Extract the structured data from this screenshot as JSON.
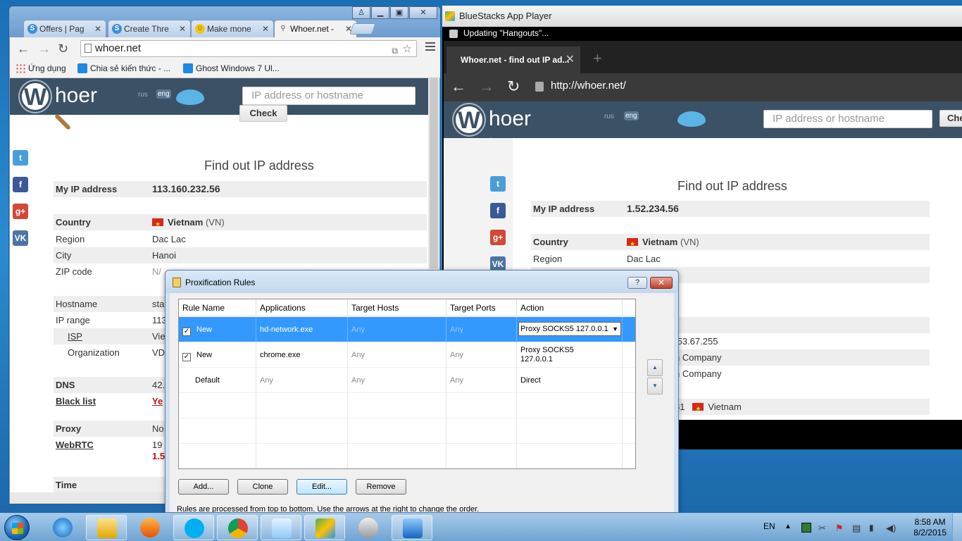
{
  "chrome": {
    "tabs": [
      {
        "label": "Offers | Pag",
        "icon": "skype-icon"
      },
      {
        "label": "Create Thre",
        "icon": "skype-icon"
      },
      {
        "label": "Make mone",
        "icon": "smiley-icon"
      },
      {
        "label": "Whoer.net -",
        "icon": "search-icon"
      }
    ],
    "url": "whoer.net",
    "bookmarks": [
      {
        "label": "Ứng dụng",
        "icon": "apps-grid-icon"
      },
      {
        "label": "Chia sẻ kiến thức - ...",
        "icon": "windows-icon"
      },
      {
        "label": "Ghost Windows 7 Ul...",
        "icon": "windows-icon"
      }
    ]
  },
  "whoer": {
    "logo_w": "W",
    "logo_rest": "hoer",
    "lang_rus": "rus",
    "lang_eng": "eng",
    "search_placeholder": "IP address or hostname",
    "check_label": "Check",
    "title": "Find out IP address"
  },
  "left_info": {
    "my_ip_label": "My IP address",
    "my_ip": "113.160.232.56",
    "rows": [
      {
        "k": "Country",
        "v": "Vietnam",
        "v2": "(VN)"
      },
      {
        "k": "Region",
        "v": "Dac Lac"
      },
      {
        "k": "City",
        "v": "Hanoi"
      },
      {
        "k": "ZIP code",
        "v": "N/"
      },
      {
        "k": "Hostname",
        "v": "sta"
      },
      {
        "k": "IP range",
        "v": "113"
      },
      {
        "k": "ISP",
        "v": "Vie"
      },
      {
        "k": "Organization",
        "v": "VD"
      },
      {
        "k": "DNS",
        "v": "42."
      },
      {
        "k": "Black list",
        "v": "Ye"
      },
      {
        "k": "Proxy",
        "v": "No"
      },
      {
        "k": "WebRTC",
        "v": "19",
        "v2": "1.5"
      },
      {
        "k": "Time",
        "v": ""
      }
    ]
  },
  "bluestacks": {
    "title": "BlueStacks App Player",
    "notification": "Updating \"Hangouts\"...",
    "tab_title": "Whoer.net - find out IP ad...",
    "url": "http://whoer.net/",
    "check_partial": "Che",
    "my_ip_label": "My IP address",
    "my_ip": "1.52.234.56",
    "country_label": "Country",
    "country": "Vietnam",
    "country_code": "(VN)",
    "region_label": "Region",
    "region": "Dac Lac",
    "ip_range_partial": ".53.67.255",
    "isp_partial": "n Company",
    "org_partial": "n Company",
    "dns_partial": "81",
    "dns_country": "Vietnam"
  },
  "dialog": {
    "title": "Proxification Rules",
    "help": "?",
    "columns": [
      "Rule Name",
      "Applications",
      "Target Hosts",
      "Target Ports",
      "Action"
    ],
    "rows": [
      {
        "name": "New",
        "checked": true,
        "apps": "hd-network.exe",
        "hosts": "Any",
        "ports": "Any",
        "action": "Proxy SOCKS5 127.0.0.1"
      },
      {
        "name": "New",
        "checked": true,
        "apps": "chrome.exe",
        "hosts": "Any",
        "ports": "Any",
        "action_line1": "Proxy SOCKS5",
        "action_line2": "127.0.0.1"
      },
      {
        "name": "Default",
        "checked": false,
        "apps": "Any",
        "hosts": "Any",
        "ports": "Any",
        "action": "Direct"
      }
    ],
    "buttons": {
      "add": "Add...",
      "clone": "Clone",
      "edit": "Edit...",
      "remove": "Remove"
    },
    "note": "Rules are processed from top to bottom. Use the arrows at the right to change the order."
  },
  "taskbar": {
    "apps": [
      "internet-explorer-icon",
      "file-explorer-icon",
      "media-player-icon",
      "skype-icon",
      "chrome-icon",
      "notepad-icon",
      "bluestacks-icon",
      "network-tool-icon",
      "proxifier-icon"
    ],
    "language": "EN",
    "time": "8:58 AM",
    "date": "8/2/2015"
  },
  "colors": {
    "whoer_header": "#3b5166",
    "selection": "#3399ff",
    "desktop": "#1b6fb4"
  }
}
